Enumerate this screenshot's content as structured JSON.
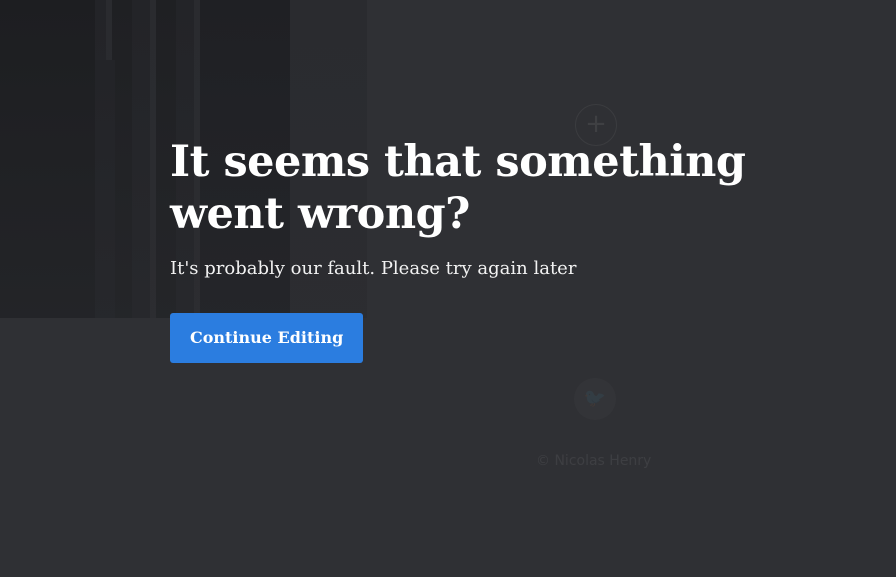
{
  "error": {
    "headline": "It seems that something went wrong?",
    "message": "It's probably our fault. Please try again later",
    "button_label": "Continue Editing"
  },
  "background": {
    "plus_glyph": "+",
    "twitter_glyph": "🐦",
    "credit_text": "© Nicolas Henry"
  },
  "colors": {
    "page_background": "#2f3034",
    "button": "#2b7de0",
    "text": "#ffffff"
  }
}
